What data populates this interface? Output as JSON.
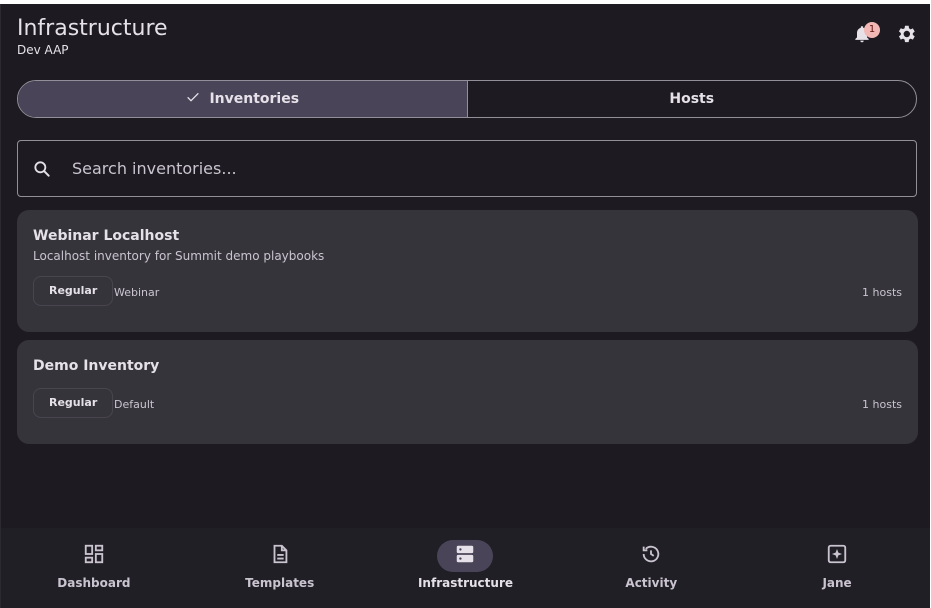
{
  "header": {
    "title": "Infrastructure",
    "subtitle": "Dev AAP",
    "notification_count": "1",
    "icons": [
      "bell-icon",
      "gear-icon"
    ]
  },
  "tabs": [
    {
      "label": "Inventories",
      "active": true
    },
    {
      "label": "Hosts",
      "active": false
    }
  ],
  "search": {
    "placeholder": "Search inventories..."
  },
  "inventories": [
    {
      "name": "Webinar Localhost",
      "description": "Localhost inventory for Summit demo playbooks",
      "kind": "Regular",
      "organization": "Webinar",
      "hosts": "1 hosts"
    },
    {
      "name": "Demo Inventory",
      "description": "",
      "kind": "Regular",
      "organization": "Default",
      "hosts": "1 hosts"
    }
  ],
  "nav": [
    {
      "label": "Dashboard",
      "icon": "dashboard-icon",
      "active": false
    },
    {
      "label": "Templates",
      "icon": "document-icon",
      "active": false
    },
    {
      "label": "Infrastructure",
      "icon": "server-icon",
      "active": true
    },
    {
      "label": "Activity",
      "icon": "history-icon",
      "active": false
    },
    {
      "label": "Jane",
      "icon": "sparkle-icon",
      "active": false
    }
  ],
  "colors": {
    "background": "#1d1b21",
    "surface": "#36343b",
    "active_segment": "#4a4458",
    "badge": "#f2b8b5",
    "outline": "#938f99"
  }
}
